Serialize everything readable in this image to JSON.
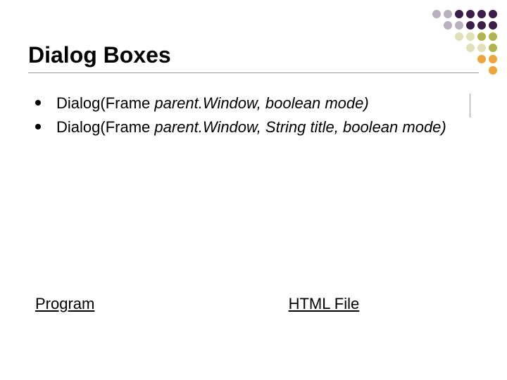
{
  "title": "Dialog Boxes",
  "bullets": [
    {
      "prefix": "Dialog(Frame ",
      "mid": "parent.Window, boolean mode)",
      "suffix": ""
    },
    {
      "prefix": "Dialog(Frame ",
      "mid": "parent.Window, String title, boolean mode)",
      "suffix": ""
    }
  ],
  "links": {
    "program": "Program",
    "html_file": "HTML File"
  }
}
